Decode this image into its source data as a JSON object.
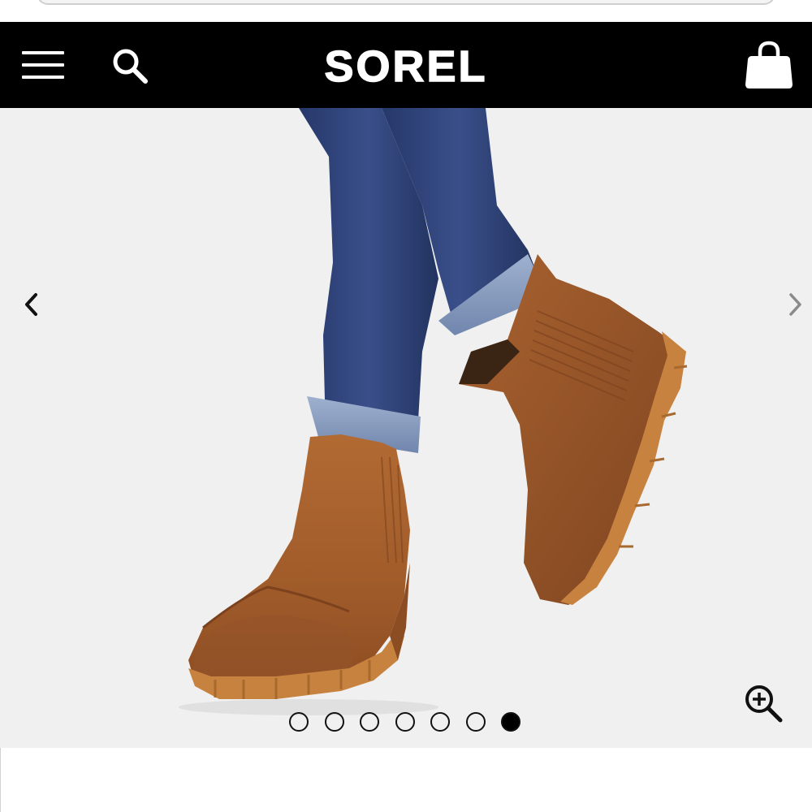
{
  "header": {
    "brand": "SOREL",
    "menu_icon": "hamburger-menu-icon",
    "search_icon": "search-icon",
    "cart_icon": "shopping-bag-icon",
    "background": "#000000",
    "foreground": "#ffffff"
  },
  "gallery": {
    "prev_icon": "chevron-left-icon",
    "next_icon": "chevron-right-icon",
    "zoom_icon": "zoom-in-icon",
    "background": "#f0f0f0",
    "slide_count": 7,
    "active_slide": 7,
    "boot_color": "#a8632f",
    "sole_color": "#c8823f",
    "denim_color": "#2c3f73"
  }
}
